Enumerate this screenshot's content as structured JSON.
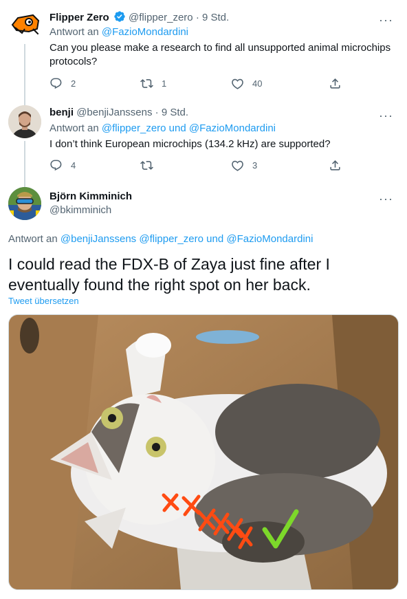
{
  "tweets": [
    {
      "name": "Flipper Zero",
      "verified": true,
      "handle": "@flipper_zero",
      "time": "9 Std.",
      "reply_prefix": "Antwort an",
      "reply_to": "@FazioMondardini",
      "text": "Can you please make a research to find all unsupported animal microchips protocols?",
      "replies": "2",
      "retweets": "1",
      "likes": "40"
    },
    {
      "name": "benji",
      "handle": "@benjiJanssens",
      "time": "9 Std.",
      "reply_prefix": "Antwort an",
      "reply_to_1": "@flipper_zero",
      "reply_joiner": "und",
      "reply_to_2": "@FazioMondardini",
      "text": "I don’t think European microchips (134.2 kHz) are supported?",
      "replies": "4",
      "retweets": "",
      "likes": "3"
    }
  ],
  "main_tweet": {
    "name": "Björn Kimminich",
    "handle": "@bkimminich",
    "reply_prefix": "Antwort an",
    "reply_to_1": "@benjiJanssens",
    "reply_to_2": "@flipper_zero",
    "reply_joiner": "und",
    "reply_to_3": "@FazioMondardini",
    "text": "I could read the FDX-B of Zaya just fine after I eventually found the right spot on her back.",
    "translate_label": "Tweet übersetzen"
  },
  "icons": {
    "more": "more-icon",
    "reply": "reply-icon",
    "retweet": "retweet-icon",
    "like": "like-icon",
    "share": "share-icon",
    "verified": "verified-badge-icon"
  },
  "colors": {
    "link": "#1d9bf0",
    "secondary": "#536471",
    "thread_line": "#cfd9de",
    "flipper_orange": "#ff8200"
  }
}
